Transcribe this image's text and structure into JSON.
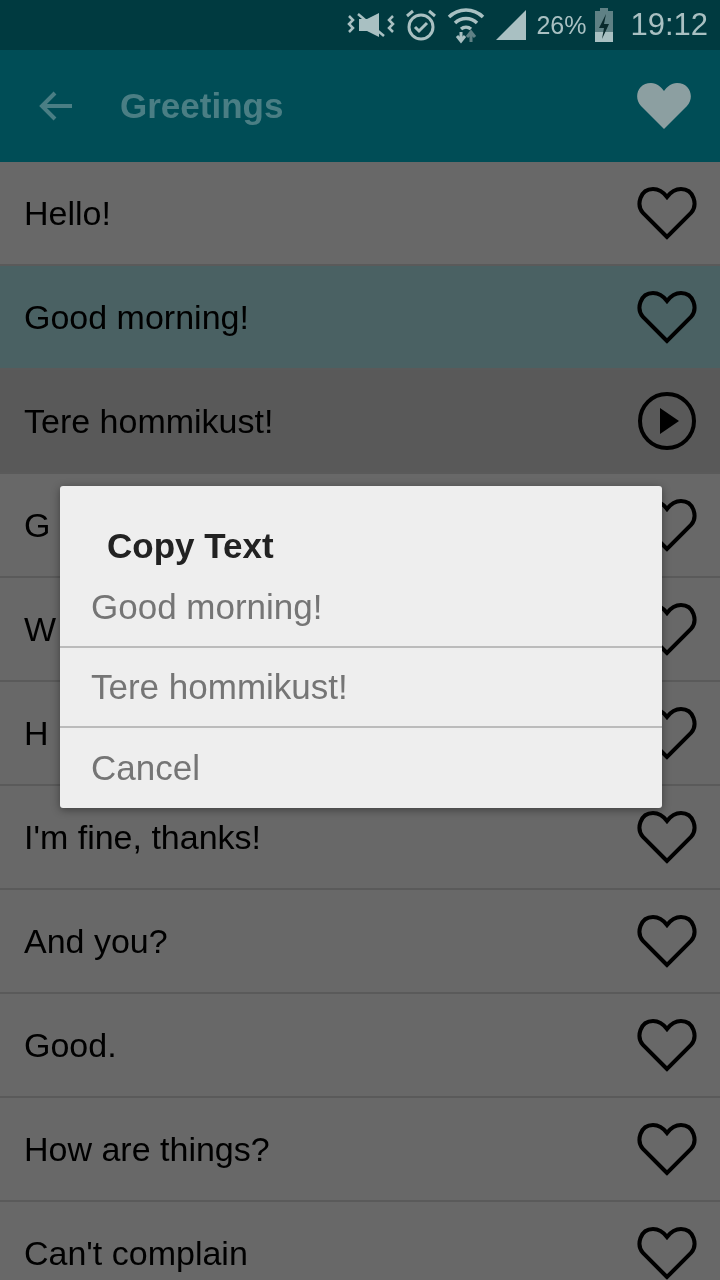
{
  "status_bar": {
    "battery": "26%",
    "time": "19:12"
  },
  "app_bar": {
    "title": "Greetings"
  },
  "rows": [
    {
      "text": "Hello!",
      "kind": "phrase",
      "selected": false,
      "favorite": false
    },
    {
      "text": "Good morning!",
      "kind": "phrase",
      "selected": true,
      "favorite": false
    },
    {
      "text": "Tere hommikust!",
      "kind": "translation",
      "selected": false
    },
    {
      "text": "G",
      "kind": "phrase",
      "selected": false,
      "favorite": false
    },
    {
      "text": "W",
      "kind": "phrase",
      "selected": false,
      "favorite": false
    },
    {
      "text": "H",
      "kind": "phrase",
      "selected": false,
      "favorite": false
    },
    {
      "text": "I'm fine, thanks!",
      "kind": "phrase",
      "selected": false,
      "favorite": false
    },
    {
      "text": "And you?",
      "kind": "phrase",
      "selected": false,
      "favorite": false
    },
    {
      "text": "Good.",
      "kind": "phrase",
      "selected": false,
      "favorite": false
    },
    {
      "text": "How are things?",
      "kind": "phrase",
      "selected": false,
      "favorite": false
    },
    {
      "text": "Can't complain",
      "kind": "phrase",
      "selected": false,
      "favorite": false
    }
  ],
  "dialog": {
    "title": "Copy Text",
    "options": [
      "Good morning!",
      "Tere hommikust!",
      "Cancel"
    ]
  }
}
